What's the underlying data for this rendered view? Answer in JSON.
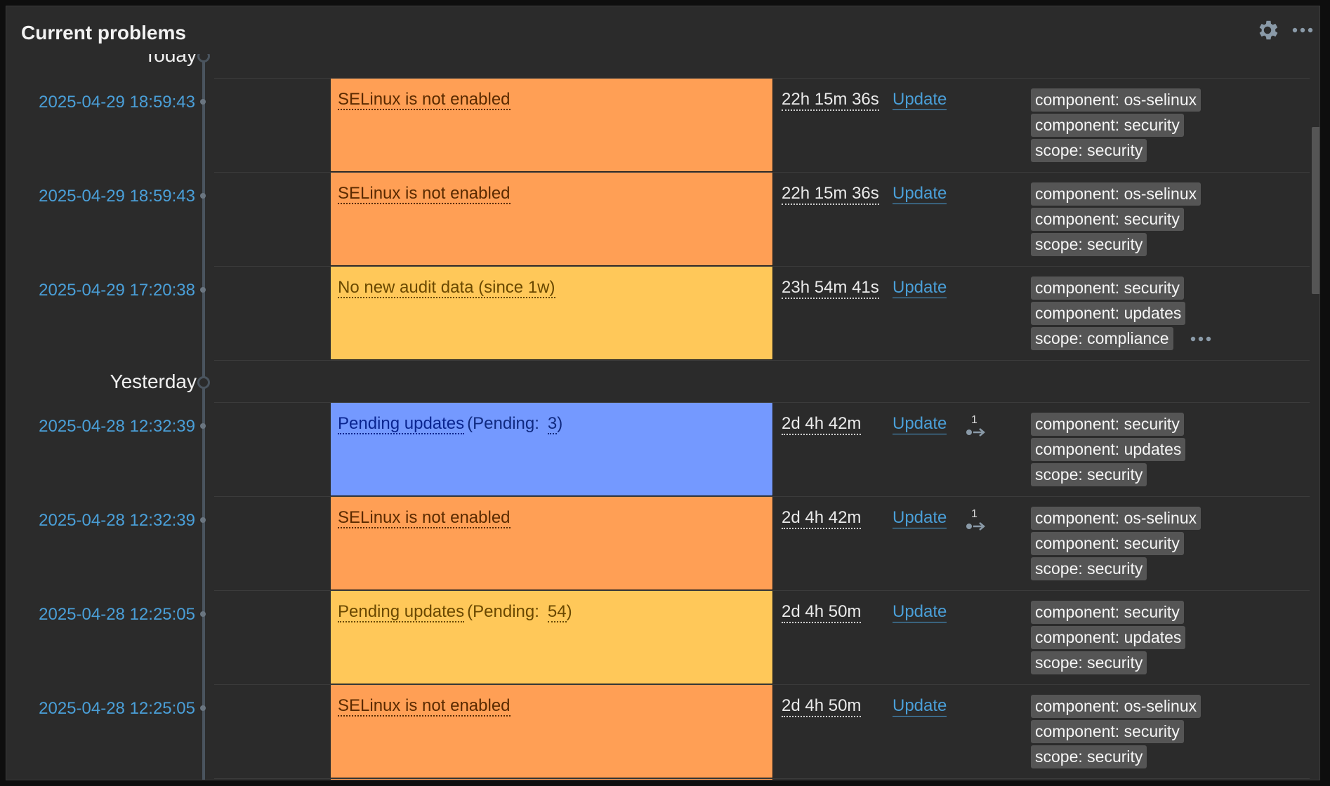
{
  "widget": {
    "title": "Current problems",
    "settings_icon": "gear-icon",
    "menu_icon": "more-horizontal-icon"
  },
  "groups": [
    {
      "label": "Today"
    },
    {
      "label": "Yesterday"
    }
  ],
  "rows": [
    {
      "time": "2025-04-29 18:59:43",
      "severity": "high",
      "name": "SELinux is not enabled",
      "pending": "",
      "duration": "22h 15m 36s",
      "update": "Update",
      "escalation": "",
      "tags": [
        "component: os-selinux",
        "component: security",
        "scope: security"
      ],
      "more_tags": false
    },
    {
      "time": "2025-04-29 18:59:43",
      "severity": "high",
      "name": "SELinux is not enabled",
      "pending": "",
      "duration": "22h 15m 36s",
      "update": "Update",
      "escalation": "",
      "tags": [
        "component: os-selinux",
        "component: security",
        "scope: security"
      ],
      "more_tags": false
    },
    {
      "time": "2025-04-29 17:20:38",
      "severity": "average",
      "name": "No new audit data (since 1w)",
      "pending": "",
      "duration": "23h 54m 41s",
      "update": "Update",
      "escalation": "",
      "tags": [
        "component: security",
        "component: updates",
        "scope: compliance"
      ],
      "more_tags": true
    },
    {
      "time": "2025-04-28 12:32:39",
      "severity": "info",
      "name": "Pending updates",
      "pending": "3",
      "pending_label": "(Pending:",
      "pending_close": ")",
      "duration": "2d 4h 42m",
      "update": "Update",
      "escalation": "1",
      "tags": [
        "component: security",
        "component: updates",
        "scope: security"
      ],
      "more_tags": false
    },
    {
      "time": "2025-04-28 12:32:39",
      "severity": "high",
      "name": "SELinux is not enabled",
      "pending": "",
      "duration": "2d 4h 42m",
      "update": "Update",
      "escalation": "1",
      "tags": [
        "component: os-selinux",
        "component: security",
        "scope: security"
      ],
      "more_tags": false
    },
    {
      "time": "2025-04-28 12:25:05",
      "severity": "average",
      "name": "Pending updates",
      "pending": "54",
      "pending_label": "(Pending:",
      "pending_close": ")",
      "duration": "2d 4h 50m",
      "update": "Update",
      "escalation": "",
      "tags": [
        "component: security",
        "component: updates",
        "scope: security"
      ],
      "more_tags": false
    },
    {
      "time": "2025-04-28 12:25:05",
      "severity": "high",
      "name": "SELinux is not enabled",
      "pending": "",
      "duration": "2d 4h 50m",
      "update": "Update",
      "escalation": "",
      "tags": [
        "component: os-selinux",
        "component: security",
        "scope: security"
      ],
      "more_tags": false
    }
  ],
  "colors": {
    "high": "#ff9f55",
    "average": "#ffc859",
    "info": "#7499ff",
    "link": "#4a9fd8"
  }
}
